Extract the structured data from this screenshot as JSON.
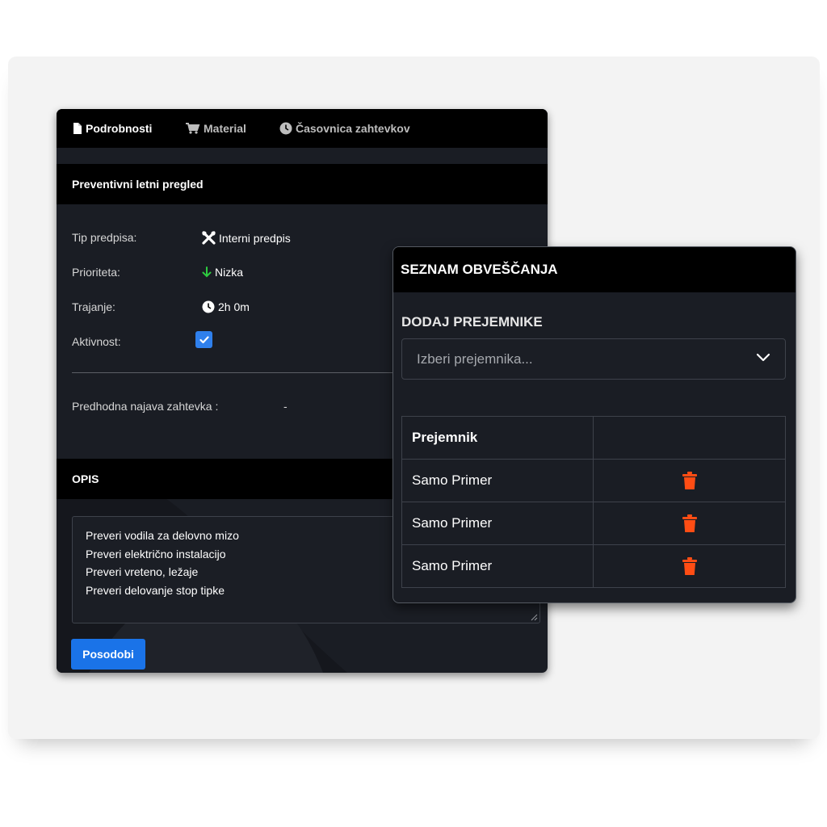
{
  "tabs": [
    {
      "label": "Podrobnosti",
      "icon": "file-icon",
      "active": true
    },
    {
      "label": "Material",
      "icon": "cart-icon",
      "active": false
    },
    {
      "label": "Časovnica zahtevkov",
      "icon": "clock-icon",
      "active": false
    }
  ],
  "details": {
    "title": "Preventivni letni pregled",
    "fields": {
      "type": {
        "label": "Tip predpisa:",
        "value": "Interni predpis"
      },
      "priority": {
        "label": "Prioriteta:",
        "value": "Nizka"
      },
      "duration": {
        "label": "Trajanje:",
        "value": "2h 0m"
      },
      "activity": {
        "label": "Aktivnost:",
        "checked": true
      }
    },
    "previous": {
      "label": "Predhodna najava zahtevka :",
      "value": "-"
    }
  },
  "description": {
    "header": "OPIS",
    "lines": [
      "Preveri vodila za delovno mizo",
      "Preveri električno instalacijo",
      "Preveri vreteno, ležaje",
      "Preveri delovanje stop tipke"
    ]
  },
  "update_button": "Posodobi",
  "notify": {
    "header": "SEZNAM OBVEŠČANJA",
    "add_label": "DODAJ PREJEMNIKE",
    "select_placeholder": "Izberi prejemnika...",
    "table": {
      "column_header": "Prejemnik",
      "rows": [
        "Samo Primer",
        "Samo Primer",
        "Samo Primer"
      ]
    }
  },
  "colors": {
    "panel_bg": "#1a1d24",
    "header_bg": "#000000",
    "accent_blue": "#1a73e8",
    "checkbox_blue": "#2f80ed",
    "priority_green": "#2ecc40",
    "delete_red": "#ff4d14"
  }
}
